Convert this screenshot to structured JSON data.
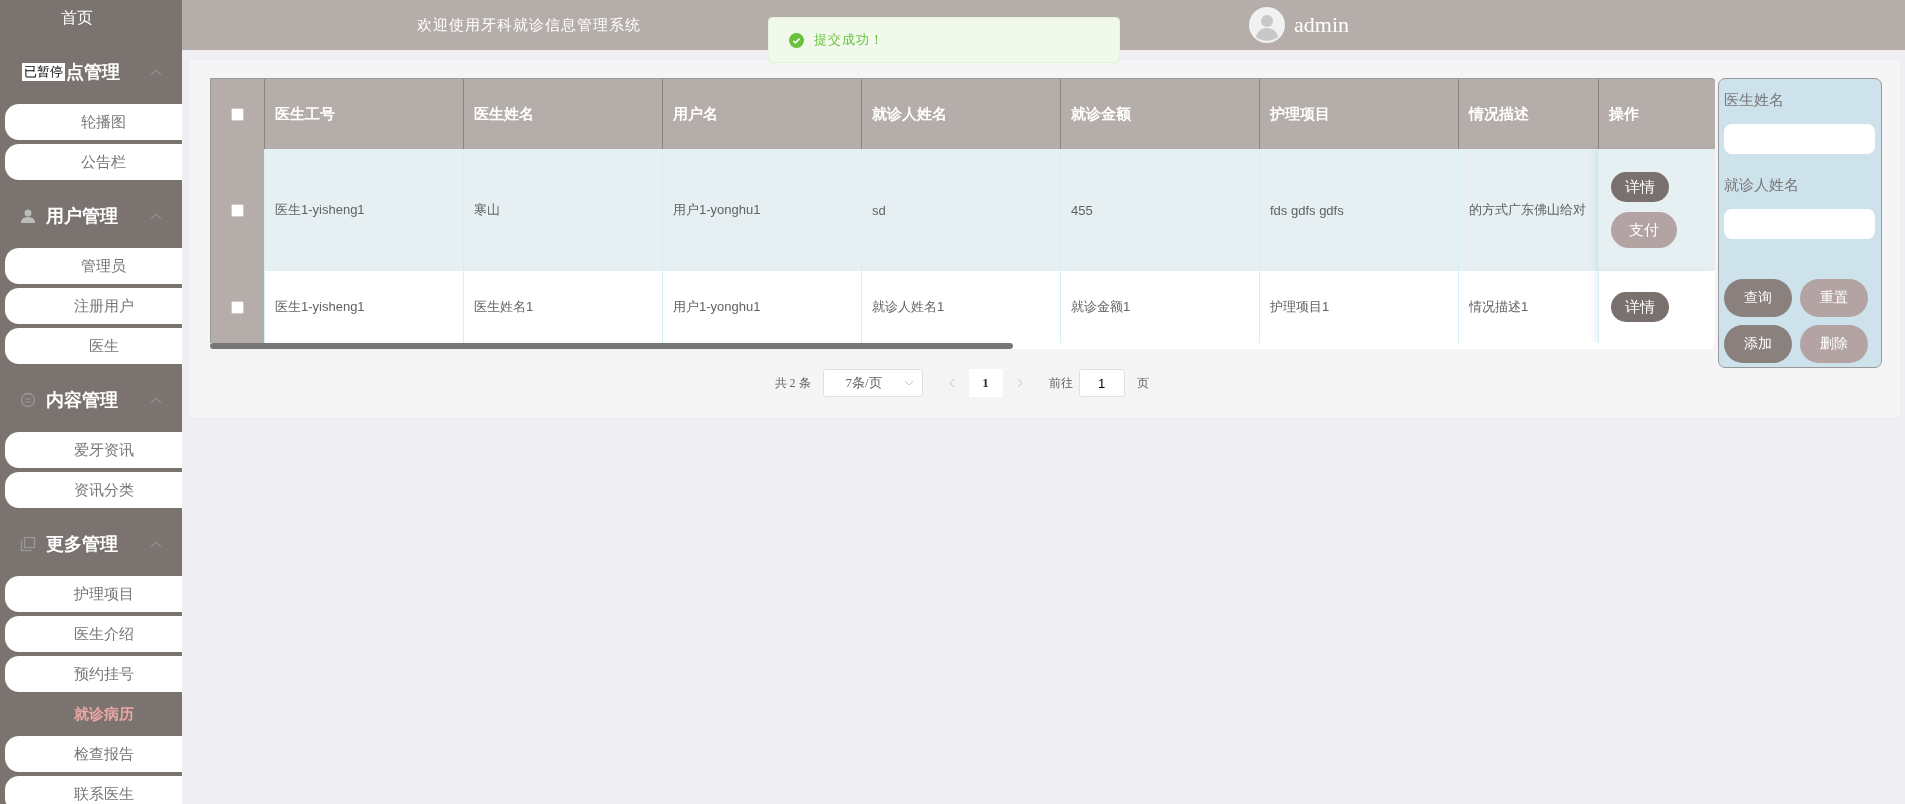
{
  "sidebar": {
    "home": "首页",
    "groups": [
      {
        "title": "点管理",
        "expanded": true,
        "items": [
          {
            "label": "轮播图",
            "selected": false
          },
          {
            "label": "公告栏",
            "selected": false
          }
        ]
      },
      {
        "title": "用户管理",
        "expanded": true,
        "items": [
          {
            "label": "管理员",
            "selected": false
          },
          {
            "label": "注册用户",
            "selected": false
          },
          {
            "label": "医生",
            "selected": false
          }
        ]
      },
      {
        "title": "内容管理",
        "expanded": true,
        "items": [
          {
            "label": "爱牙资讯",
            "selected": false
          },
          {
            "label": "资讯分类",
            "selected": false
          }
        ]
      },
      {
        "title": "更多管理",
        "expanded": true,
        "items": [
          {
            "label": "护理项目",
            "selected": false
          },
          {
            "label": "医生介绍",
            "selected": false
          },
          {
            "label": "预约挂号",
            "selected": false
          },
          {
            "label": "就诊病历",
            "selected": true
          },
          {
            "label": "检查报告",
            "selected": false
          },
          {
            "label": "联系医生",
            "selected": false
          }
        ]
      }
    ]
  },
  "video_overlay": "已暂停",
  "header": {
    "welcome": "欢迎使用牙科就诊信息管理系统",
    "user": "admin"
  },
  "toast": {
    "message": "提交成功！"
  },
  "table": {
    "all_checked": false,
    "columns": [
      "医生工号",
      "医生姓名",
      "用户名",
      "就诊人姓名",
      "就诊金额",
      "护理项目",
      "情况描述",
      "操作"
    ],
    "rows": [
      {
        "checked": false,
        "highlighted": true,
        "cells": [
          "医生1-yisheng1",
          "寒山",
          "用户1-yonghu1",
          "sd",
          "455",
          "fds gdfs gdfs",
          "的方式广东佛山给对"
        ],
        "actions": [
          {
            "label": "详情",
            "disabled": false
          },
          {
            "label": "支付",
            "disabled": true
          }
        ]
      },
      {
        "checked": false,
        "highlighted": false,
        "cells": [
          "医生1-yisheng1",
          "医生姓名1",
          "用户1-yonghu1",
          "就诊人姓名1",
          "就诊金额1",
          "护理项目1",
          "情况描述1"
        ],
        "actions": [
          {
            "label": "详情",
            "disabled": false
          }
        ]
      }
    ]
  },
  "pagination": {
    "total": "共 2 条",
    "page_size": "7条/页",
    "pages": [
      {
        "label": "1",
        "selected": true
      }
    ],
    "goto_label": "前往",
    "goto_value": "1",
    "page_suffix": "页"
  },
  "search_panel": {
    "fields": [
      {
        "label": "医生姓名"
      },
      {
        "label": "就诊人姓名"
      }
    ],
    "buttons": [
      {
        "label": "查询",
        "disabled": false
      },
      {
        "label": "重置",
        "disabled": true
      },
      {
        "label": "添加",
        "disabled": false
      },
      {
        "label": "删除",
        "disabled": true
      }
    ]
  }
}
